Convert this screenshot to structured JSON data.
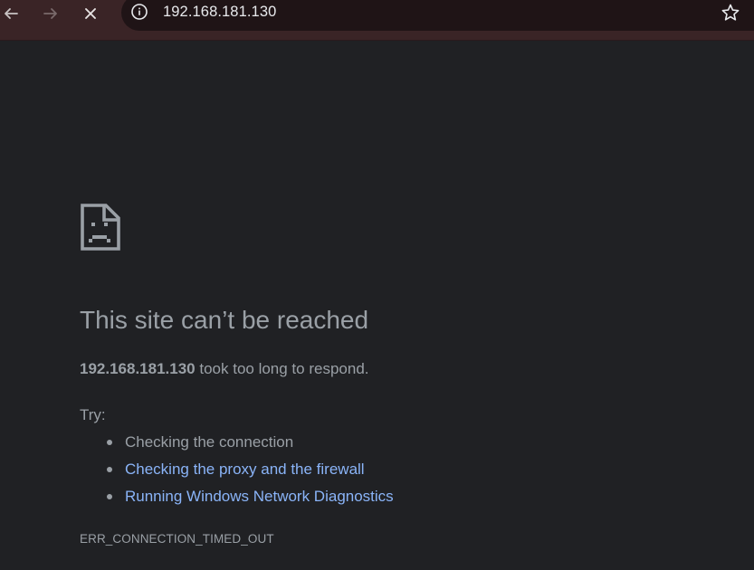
{
  "browser": {
    "url": "192.168.181.130",
    "colors": {
      "toolbar": "#3a2426",
      "omnibox": "#1f1416",
      "page_background": "#202124",
      "text": "#9aa0a6",
      "link": "#8ab4f8"
    }
  },
  "error_page": {
    "icon": "sad-file-icon",
    "title": "This site can’t be reached",
    "host": "192.168.181.130",
    "message": "took too long to respond.",
    "try_label": "Try:",
    "suggestions": [
      {
        "label": "Checking the connection",
        "is_link": false
      },
      {
        "label": "Checking the proxy and the firewall",
        "is_link": true
      },
      {
        "label": "Running Windows Network Diagnostics",
        "is_link": true
      }
    ],
    "error_code": "ERR_CONNECTION_TIMED_OUT"
  }
}
